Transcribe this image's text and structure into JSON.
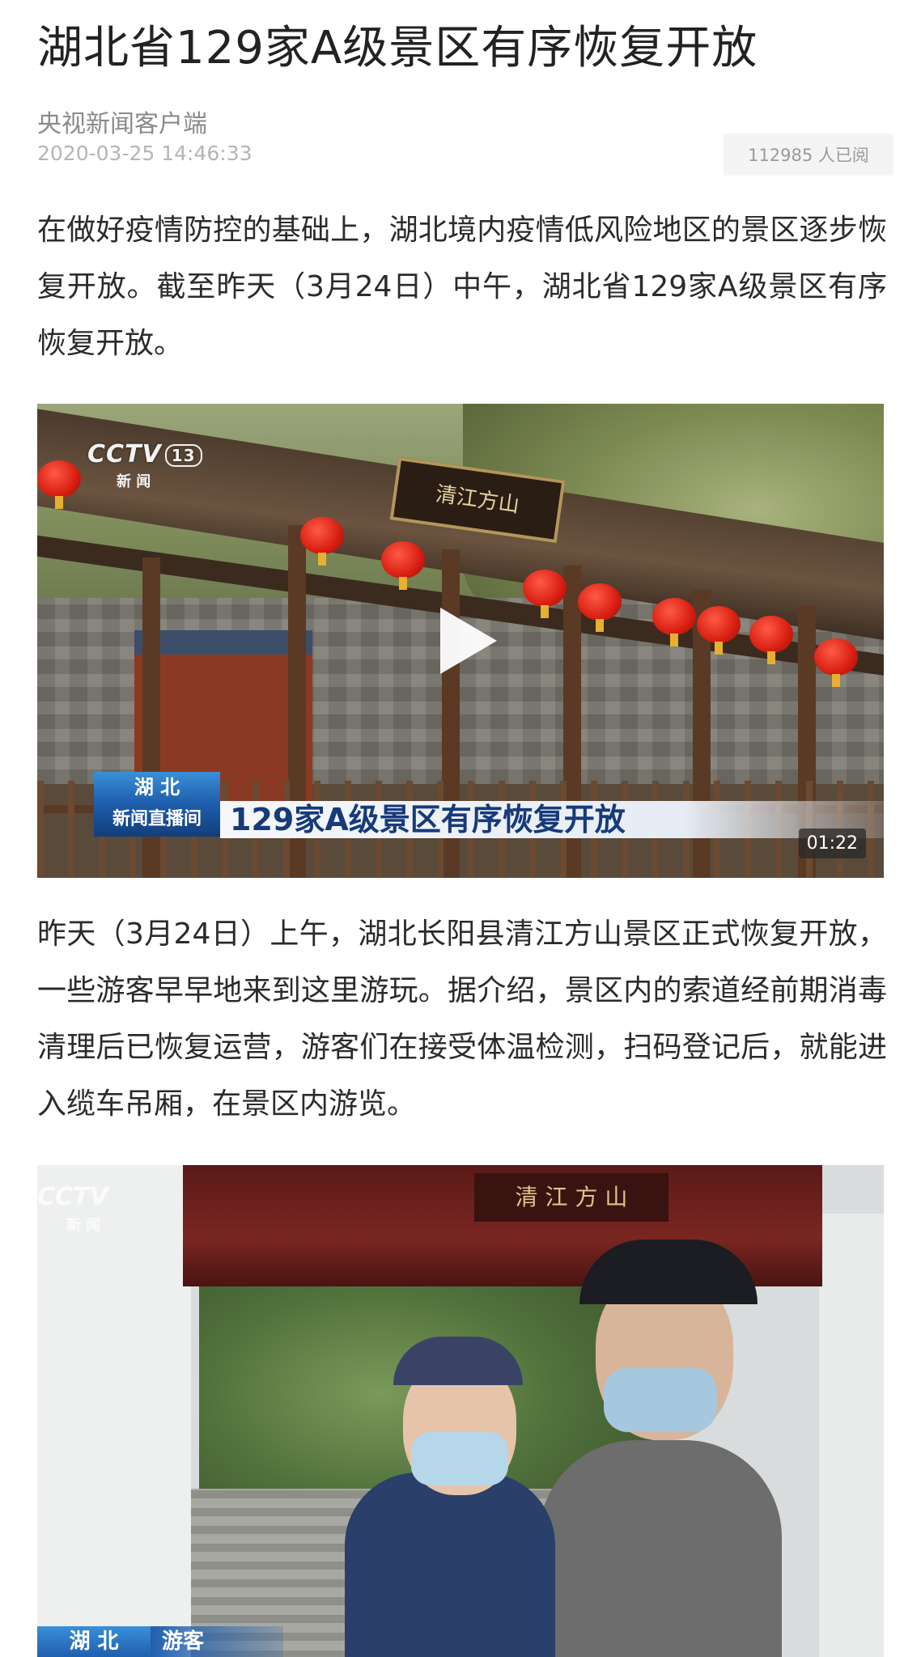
{
  "article": {
    "title": "湖北省129家A级景区有序恢复开放",
    "source": "央视新闻客户端",
    "timestamp": "2020-03-25 14:46:33",
    "read_count": "112985 人已阅",
    "paragraph_1": "在做好疫情防控的基础上，湖北境内疫情低风险地区的景区逐步恢复开放。截至昨天（3月24日）中午，湖北省129家A级景区有序恢复开放。",
    "paragraph_2": "昨天（3月24日）上午，湖北长阳县清江方山景区正式恢复开放，一些游客早早地来到这里游玩。据介绍，景区内的索道经前期消毒清理后已恢复运营，游客们在接受体温检测，扫码登记后，就能进入缆车吊厢，在景区内游览。"
  },
  "video_1": {
    "logo": "CCTV",
    "channel": "13",
    "channel_name": "新 闻",
    "plaque": "清江方山",
    "region": "湖 北",
    "program": "新闻直播间",
    "headline": "129家A级景区有序恢复开放",
    "duration": "01:22",
    "play_icon": "play-icon"
  },
  "video_2": {
    "logo": "CCTV",
    "channel_name": "新 闻",
    "gate_sign": "清 江 方 山",
    "region": "湖 北",
    "role": "游客"
  },
  "colors": {
    "title": "#222222",
    "meta": "#8a8a8a",
    "badge_bg": "#f4f4f4",
    "lower_third_blue": "#1f5fae",
    "headline_text": "#163a7a"
  }
}
